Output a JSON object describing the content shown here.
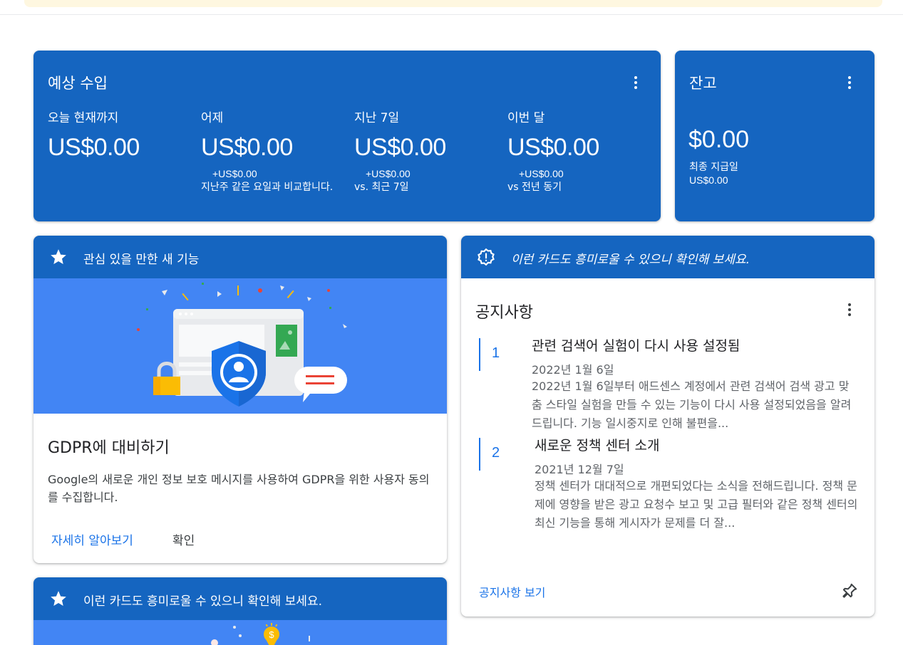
{
  "earnings": {
    "title": "예상 수입",
    "metrics": [
      {
        "label": "오늘 현재까지",
        "value": "US$0.00",
        "delta": "",
        "comparison": ""
      },
      {
        "label": "어제",
        "value": "US$0.00",
        "delta": "+US$0.00",
        "comparison": "지난주 같은 요일과 비교합니다."
      },
      {
        "label": "지난 7일",
        "value": "US$0.00",
        "delta": "+US$0.00",
        "comparison": "vs. 최근 7일"
      },
      {
        "label": "이번 달",
        "value": "US$0.00",
        "delta": "+US$0.00",
        "comparison": "vs 전년 동기"
      }
    ]
  },
  "balance": {
    "title": "잔고",
    "value": "$0.00",
    "last_payment_label": "최종 지급일",
    "last_payment_value": "US$0.00"
  },
  "feature_card": {
    "header": "관심 있을 만한 새 기능",
    "title": "GDPR에 대비하기",
    "description": "Google의 새로운 개인 정보 보호 메시지를 사용하여 GDPR을 위한 사용자 동의를 수집합니다.",
    "learn_more": "자세히 알아보기",
    "confirm": "확인"
  },
  "feature_card_2": {
    "header": "이런 카드도 흥미로울 수 있으니 확인해 보세요."
  },
  "notice_card": {
    "header": "이런 카드도 흥미로울 수 있으니 확인해 보세요.",
    "title": "공지사항",
    "items": [
      {
        "number": "1",
        "heading": "관련 검색어 실험이 다시 사용 설정됨",
        "date": "2022년 1월 6일",
        "body": "2022년 1월 6일부터 애드센스 계정에서 관련 검색어 검색 광고 맞춤 스타일 실험을 만들 수 있는 기능이 다시 사용 설정되었음을 알려드립니다. 기능 일시중지로 인해 불편을..."
      },
      {
        "number": "2",
        "heading": "새로운 정책 센터 소개",
        "date": "2021년 12월 7일",
        "body": "정책 센터가 대대적으로 개편되었다는 소식을 전해드립니다. 정책 문제에 영향을 받은 광고 요청수 보고 및 고급 필터와 같은 정책 센터의 최신 기능을 통해 게시자가 문제를 더 잘..."
      }
    ],
    "view_all": "공지사항 보기"
  },
  "colors": {
    "primary": "#1565c0",
    "accent": "#4285f4",
    "link": "#1a73e8"
  },
  "icons": [
    "more-vert-icon",
    "star-icon",
    "alert-badge-icon",
    "pin-icon"
  ]
}
